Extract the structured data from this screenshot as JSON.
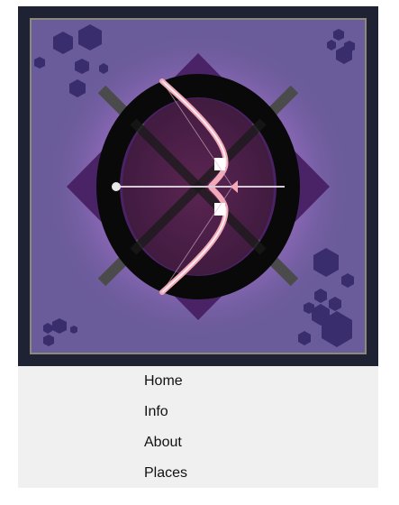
{
  "colors": {
    "frame": "#1f2233",
    "panel": "#6a5b9a",
    "glow": "#b07ad0",
    "diamond": "#4a2266",
    "shield": "#4a1f48",
    "ring": "#090909",
    "cross": "#4b4b4b",
    "bow": "#f2a9b8",
    "hexagons": "#3a2d6e",
    "menu_background": "#f0f0f0",
    "menu_text": "#111111"
  },
  "banner": {
    "icons": [
      "archery-bow-emblem-icon",
      "hexagon-cluster-icon"
    ]
  },
  "menu": {
    "items": [
      {
        "label": "Home"
      },
      {
        "label": "Info"
      },
      {
        "label": "About"
      },
      {
        "label": "Places"
      }
    ]
  }
}
